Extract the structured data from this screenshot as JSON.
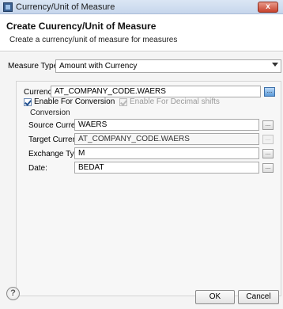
{
  "window": {
    "title": "Currency/Unit of Measure",
    "close_label": "x"
  },
  "header": {
    "title": "Create Cuurency/Unit of Measure",
    "description": "Create a currency/unit of measure for measures"
  },
  "measure_type": {
    "label": "Measure Type:",
    "selected": "Amount with Currency"
  },
  "currency": {
    "label": "Currency:",
    "value": "AT_COMPANY_CODE.WAERS"
  },
  "options": {
    "enable_conversion_label": "Enable For Conversion",
    "enable_conversion_checked": true,
    "enable_decimal_label": "Enable For Decimal shifts",
    "enable_decimal_checked": true
  },
  "conversion": {
    "title": "Conversion",
    "source_currency_label": "Source Currency:",
    "source_currency_value": "WAERS",
    "target_currency_label": "Target Currency:",
    "target_currency_value": "AT_COMPANY_CODE.WAERS",
    "exchange_type_label": "Exchange Type:",
    "exchange_type_value": "M",
    "date_label": "Date:",
    "date_value": "BEDAT"
  },
  "footer": {
    "help_label": "?",
    "ok_label": "OK",
    "cancel_label": "Cancel"
  },
  "icons": {
    "browse": "...",
    "dropdown": "chevron-down-icon"
  }
}
